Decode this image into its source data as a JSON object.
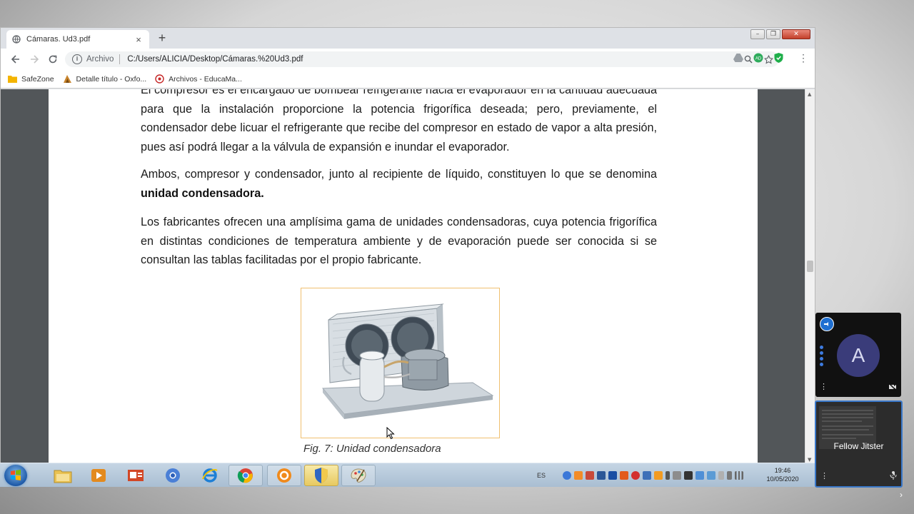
{
  "browser": {
    "tab_title": "Cámaras. Ud3.pdf",
    "tab_close": "×",
    "new_tab": "+",
    "url_scheme": "Archivo",
    "url": "C:/Users/ALICIA/Desktop/Cámaras.%20Ud3.pdf",
    "bookmarks": [
      {
        "label": "SafeZone"
      },
      {
        "label": "Detalle título - Oxfo..."
      },
      {
        "label": "Archivos - EducaMa..."
      }
    ]
  },
  "document": {
    "para0": "El compresor es el encargado de bombear refrigerante hacia el evaporador en la cantidad adecuada para que la instalación proporcione la potencia frigorífica deseada; pero, previamente, el condensador debe licuar el refrigerante que recibe del compresor en estado de vapor a alta presión, pues así podrá llegar a la válvula de expansión e inundar el evaporador.",
    "para1_text": "Ambos, compresor y condensador, junto al recipiente de líquido, constituyen lo que se denomina ",
    "para1_bold": "unidad condensadora.",
    "para2": "Los fabricantes ofrecen una amplísima gama de unidades condensadoras, cuya potencia frigorífica en distintas condiciones de temperatura ambiente y de evaporación puede ser conocida si se consultan las tablas facilitadas por el propio fabricante.",
    "caption": "Fig. 7: Unidad condensadora"
  },
  "taskbar": {
    "lang": "ES",
    "time": "19:46",
    "date": "10/05/2020"
  },
  "meeting": {
    "avatar_letter": "A",
    "participant_name": "Fellow Jitster"
  }
}
